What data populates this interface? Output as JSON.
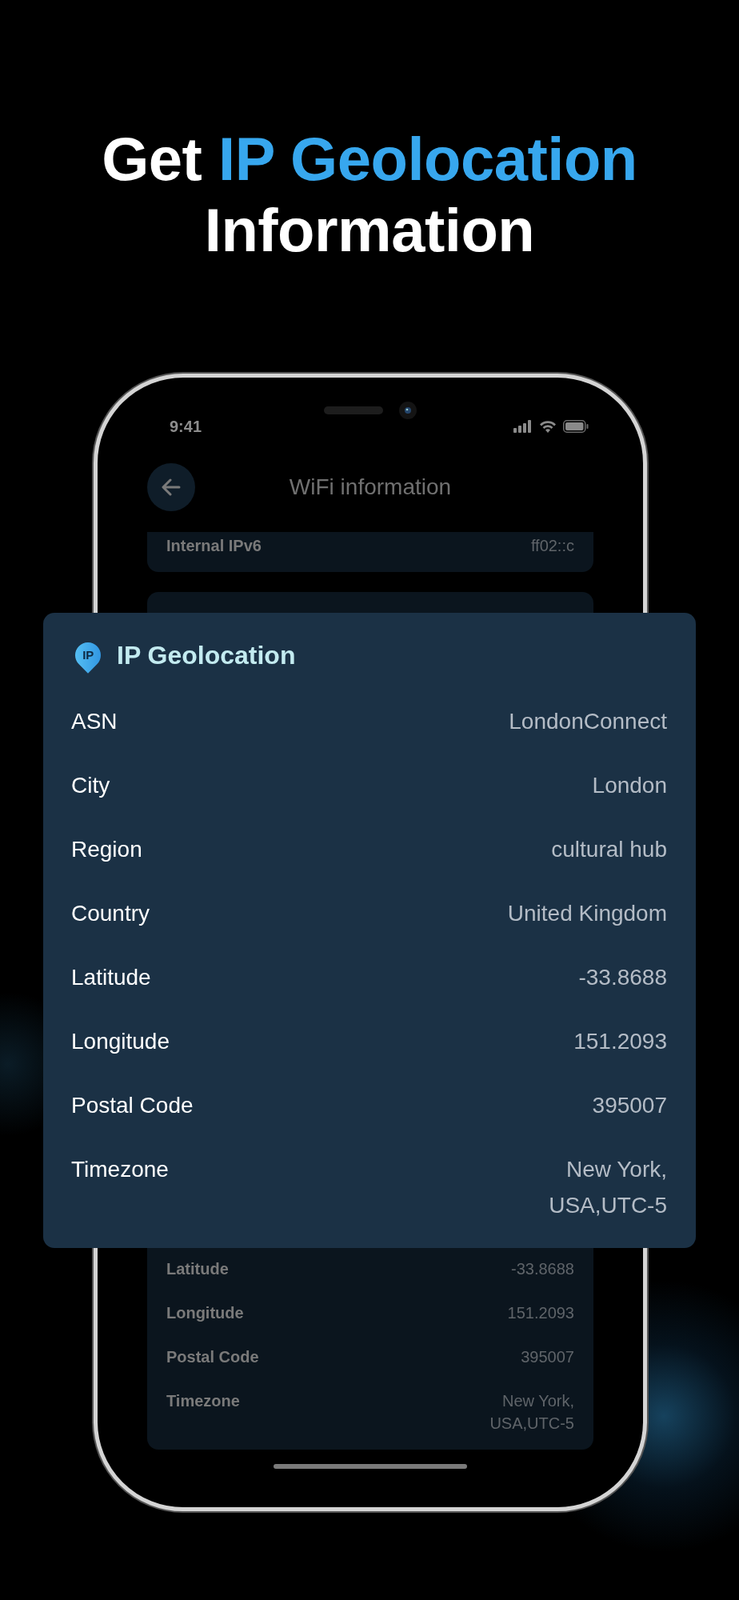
{
  "headline": [
    {
      "text": "Get",
      "highlight": false
    },
    {
      "text": "IP Geolocation",
      "highlight": true
    },
    {
      "text": "Information",
      "highlight": false
    }
  ],
  "phone": {
    "status_bar": {
      "time": "9:41"
    },
    "nav": {
      "title": "WiFi information"
    },
    "top_card": {
      "label": "Internal IPv6",
      "value": "ff02::c"
    },
    "info_card": {
      "rows": [
        {
          "label": "Latitude",
          "value": "-33.8688"
        },
        {
          "label": "Longitude",
          "value": "151.2093"
        },
        {
          "label": "Postal Code",
          "value": "395007"
        },
        {
          "label": "Timezone",
          "value": "New York,\nUSA,UTC-5"
        }
      ]
    }
  },
  "geolocation_card": {
    "icon_text": "IP",
    "title": "IP Geolocation",
    "rows": [
      {
        "label": "ASN",
        "value": "LondonConnect"
      },
      {
        "label": "City",
        "value": "London"
      },
      {
        "label": "Region",
        "value": "cultural hub"
      },
      {
        "label": "Country",
        "value": "United Kingdom"
      },
      {
        "label": "Latitude",
        "value": "-33.8688"
      },
      {
        "label": "Longitude",
        "value": "151.2093"
      },
      {
        "label": "Postal Code",
        "value": "395007"
      },
      {
        "label": "Timezone",
        "value": "New York,\nUSA,UTC-5"
      }
    ]
  }
}
